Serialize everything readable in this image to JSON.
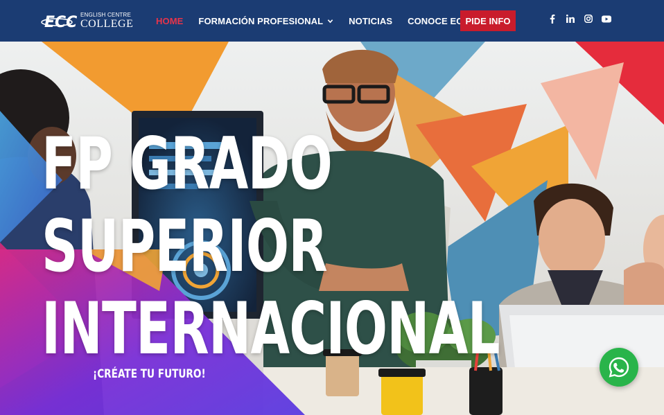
{
  "brand": {
    "mark": "ECC",
    "small": "ENGLISH CENTRE",
    "big": "COLLEGE"
  },
  "nav": {
    "items": [
      {
        "label": "HOME",
        "active": true,
        "dropdown": false
      },
      {
        "label": "FORMACIÓN PROFESIONAL",
        "active": false,
        "dropdown": true
      },
      {
        "label": "NOTICIAS",
        "active": false,
        "dropdown": false
      },
      {
        "label": "CONOCE ECC",
        "active": false,
        "dropdown": true
      }
    ],
    "cta_label": "PIDE INFO"
  },
  "social": [
    "facebook-icon",
    "linkedin-icon",
    "instagram-icon",
    "youtube-icon"
  ],
  "hero": {
    "title_lines": [
      "FP GRADO",
      "SUPERIOR",
      "INTERNACIONAL"
    ],
    "subtitle": "¡CRÉATE TU FUTURO!"
  },
  "floating": {
    "icon": "whatsapp-icon"
  },
  "colors": {
    "header_bg": "#1b3c73",
    "active_nav": "#e8344a",
    "cta_bg": "#c91c2c",
    "whatsapp": "#29b44a",
    "accent_orange": "#f0a436",
    "accent_purple": "#7b2fd6",
    "accent_magenta": "#e0297a"
  }
}
